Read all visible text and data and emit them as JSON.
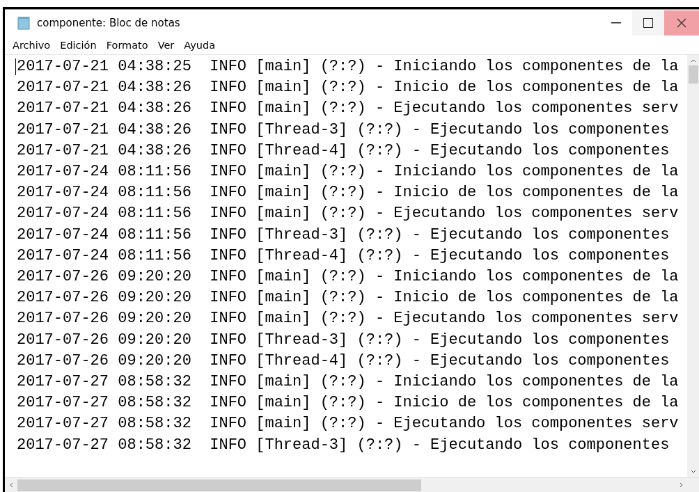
{
  "window": {
    "title": "componente: Bloc de notas"
  },
  "menu": [
    "Archivo",
    "Edición",
    "Formato",
    "Ver",
    "Ayuda"
  ],
  "lines": [
    "2017-07-21 04:38:25  INFO [main] (?:?) - Iniciando los componentes de la",
    "2017-07-21 04:38:26  INFO [main] (?:?) - Inicio de los componentes de la",
    "2017-07-21 04:38:26  INFO [main] (?:?) - Ejecutando los componentes serv",
    "2017-07-21 04:38:26  INFO [Thread-3] (?:?) - Ejecutando los componentes",
    "2017-07-21 04:38:26  INFO [Thread-4] (?:?) - Ejecutando los componentes",
    "2017-07-24 08:11:56  INFO [main] (?:?) - Iniciando los componentes de la",
    "2017-07-24 08:11:56  INFO [main] (?:?) - Inicio de los componentes de la",
    "2017-07-24 08:11:56  INFO [main] (?:?) - Ejecutando los componentes serv",
    "2017-07-24 08:11:56  INFO [Thread-3] (?:?) - Ejecutando los componentes",
    "2017-07-24 08:11:56  INFO [Thread-4] (?:?) - Ejecutando los componentes",
    "2017-07-26 09:20:20  INFO [main] (?:?) - Iniciando los componentes de la",
    "2017-07-26 09:20:20  INFO [main] (?:?) - Inicio de los componentes de la",
    "2017-07-26 09:20:20  INFO [main] (?:?) - Ejecutando los componentes serv",
    "2017-07-26 09:20:20  INFO [Thread-3] (?:?) - Ejecutando los componentes",
    "2017-07-26 09:20:20  INFO [Thread-4] (?:?) - Ejecutando los componentes",
    "2017-07-27 08:58:32  INFO [main] (?:?) - Iniciando los componentes de la",
    "2017-07-27 08:58:32  INFO [main] (?:?) - Inicio de los componentes de la",
    "2017-07-27 08:58:32  INFO [main] (?:?) - Ejecutando los componentes serv",
    "2017-07-27 08:58:32  INFO [Thread-3] (?:?) - Ejecutando los componentes"
  ]
}
